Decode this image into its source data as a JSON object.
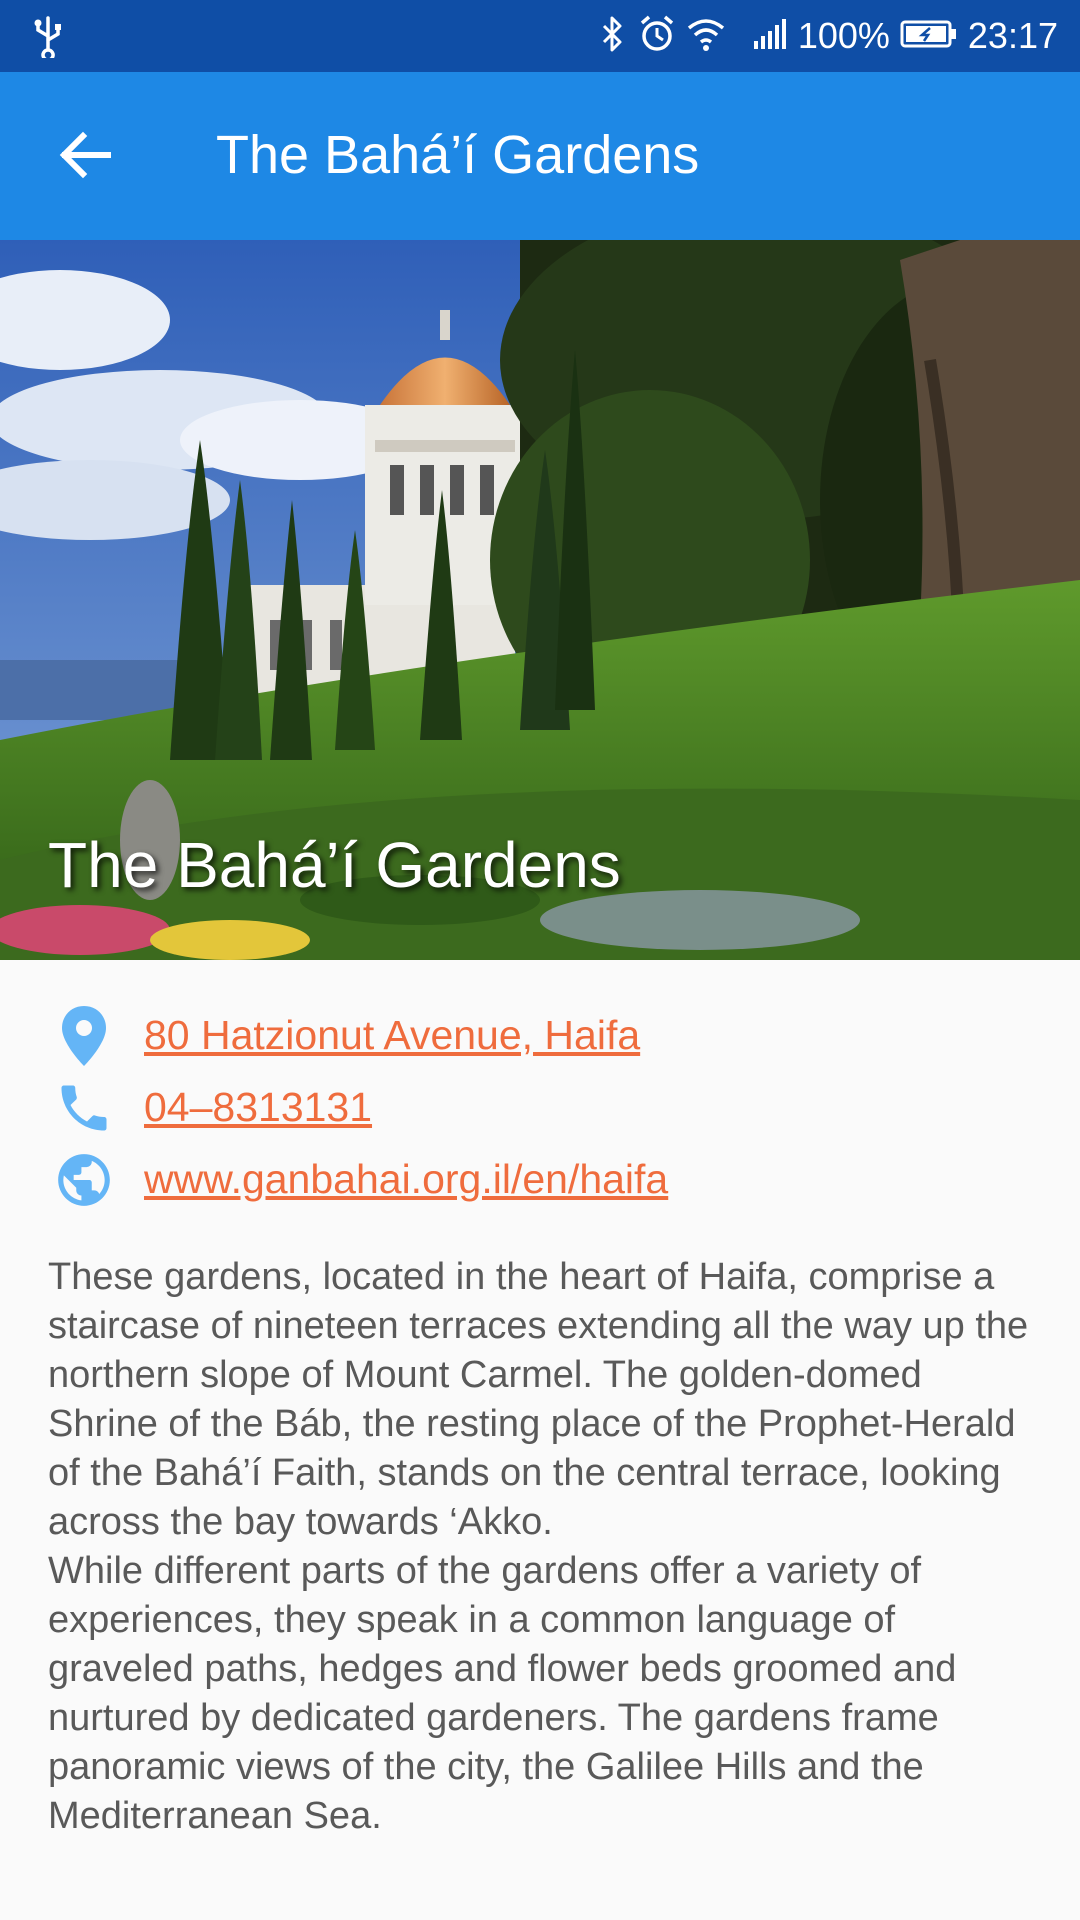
{
  "status_bar": {
    "battery": "100%",
    "time": "23:17",
    "icons": [
      "usb-icon",
      "bluetooth-icon",
      "alarm-icon",
      "wifi-icon",
      "signal-icon",
      "battery-icon"
    ]
  },
  "app_bar": {
    "title": "The Bahá’í Gardens",
    "back_icon": "arrow-left-icon"
  },
  "hero": {
    "title": "The Bahá’í Gardens"
  },
  "contacts": {
    "address": "80 Hatzionut Avenue, Haifa",
    "phone": "04–8313131",
    "website": "www.ganbahai.org.il/en/haifa"
  },
  "description": {
    "paragraph_1": "These gardens, located in the heart of Haifa, comprise a staircase of nineteen terraces extending all the way up the northern slope of Mount Carmel. The golden-domed Shrine of the Báb, the resting place of the Prophet-Herald of the Bahá’í Faith, stands on the central terrace, looking across the bay towards ‘Akko.",
    "paragraph_2": "While different parts of the gardens offer a variety of experiences, they speak in a common language of graveled paths, hedges and flower beds groomed and nurtured by dedicated gardeners. The gardens frame panoramic views of the city, the Galilee Hills and the Mediterranean Sea."
  },
  "colors": {
    "status_bar": "#0f4ea6",
    "app_bar": "#1e88e5",
    "link": "#ef6c3d",
    "icon": "#64b5f6",
    "body_text": "#595959",
    "background": "#fafafa"
  }
}
